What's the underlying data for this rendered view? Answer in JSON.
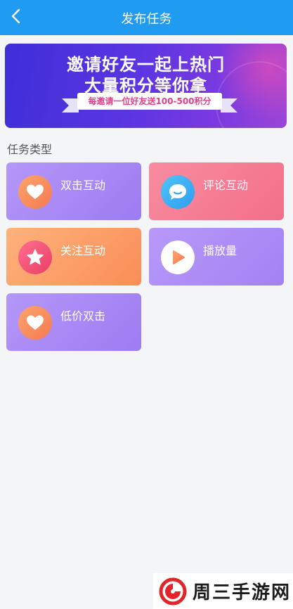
{
  "header": {
    "title": "发布任务",
    "background": "#1f9bf2"
  },
  "banner": {
    "line1": "邀请好友一起上热门",
    "line2": "大量积分等你拿",
    "ribbon_text": "每邀请一位好友送100-500积分"
  },
  "section": {
    "label": "任务类型"
  },
  "task_types": [
    {
      "label": "双击互动",
      "icon": "heart-icon"
    },
    {
      "label": "评论互动",
      "icon": "chat-bubble-icon"
    },
    {
      "label": "关注互动",
      "icon": "star-icon"
    },
    {
      "label": "播放量",
      "icon": "play-icon"
    },
    {
      "label": "低价双击",
      "icon": "heart-icon"
    }
  ],
  "watermark": {
    "text": "周三手游网"
  }
}
